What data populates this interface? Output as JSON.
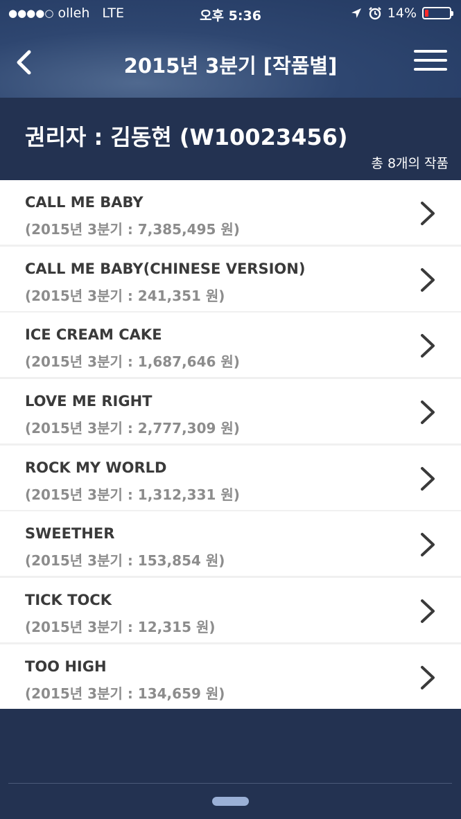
{
  "status_bar": {
    "signal": "●●●●○",
    "carrier": "olleh",
    "network": "LTE",
    "time": "오후 5:36",
    "battery": "14%",
    "battery_level": 0.14,
    "battery_color": "#ff2a2a"
  },
  "nav": {
    "title": "2015년 3분기 [작품별]",
    "back_icon": "chevron-left-icon",
    "menu_icon": "hamburger-menu-icon"
  },
  "owner": {
    "title": "권리자 : 김동현 (W10023456)",
    "count": "총 8개의 작품"
  },
  "works": [
    {
      "title": "CALL ME BABY",
      "amount": "(2015년 3분기 : 7,385,495 원)"
    },
    {
      "title": "CALL ME BABY(CHINESE VERSION)",
      "amount": "(2015년 3분기 : 241,351 원)"
    },
    {
      "title": "ICE CREAM CAKE",
      "amount": "(2015년 3분기 : 1,687,646 원)"
    },
    {
      "title": "LOVE ME RIGHT",
      "amount": "(2015년 3분기 : 2,777,309 원)"
    },
    {
      "title": "ROCK MY WORLD",
      "amount": "(2015년 3분기 : 1,312,331 원)"
    },
    {
      "title": "SWEETHER",
      "amount": "(2015년 3분기 : 153,854 원)"
    },
    {
      "title": "TICK TOCK",
      "amount": "(2015년 3분기 : 12,315 원)"
    },
    {
      "title": "TOO HIGH",
      "amount": "(2015년 3분기 : 134,659 원)"
    }
  ],
  "colors": {
    "header_bg": "#233251",
    "item_title": "#3a3a3a",
    "item_amount": "#8c8c8c"
  }
}
